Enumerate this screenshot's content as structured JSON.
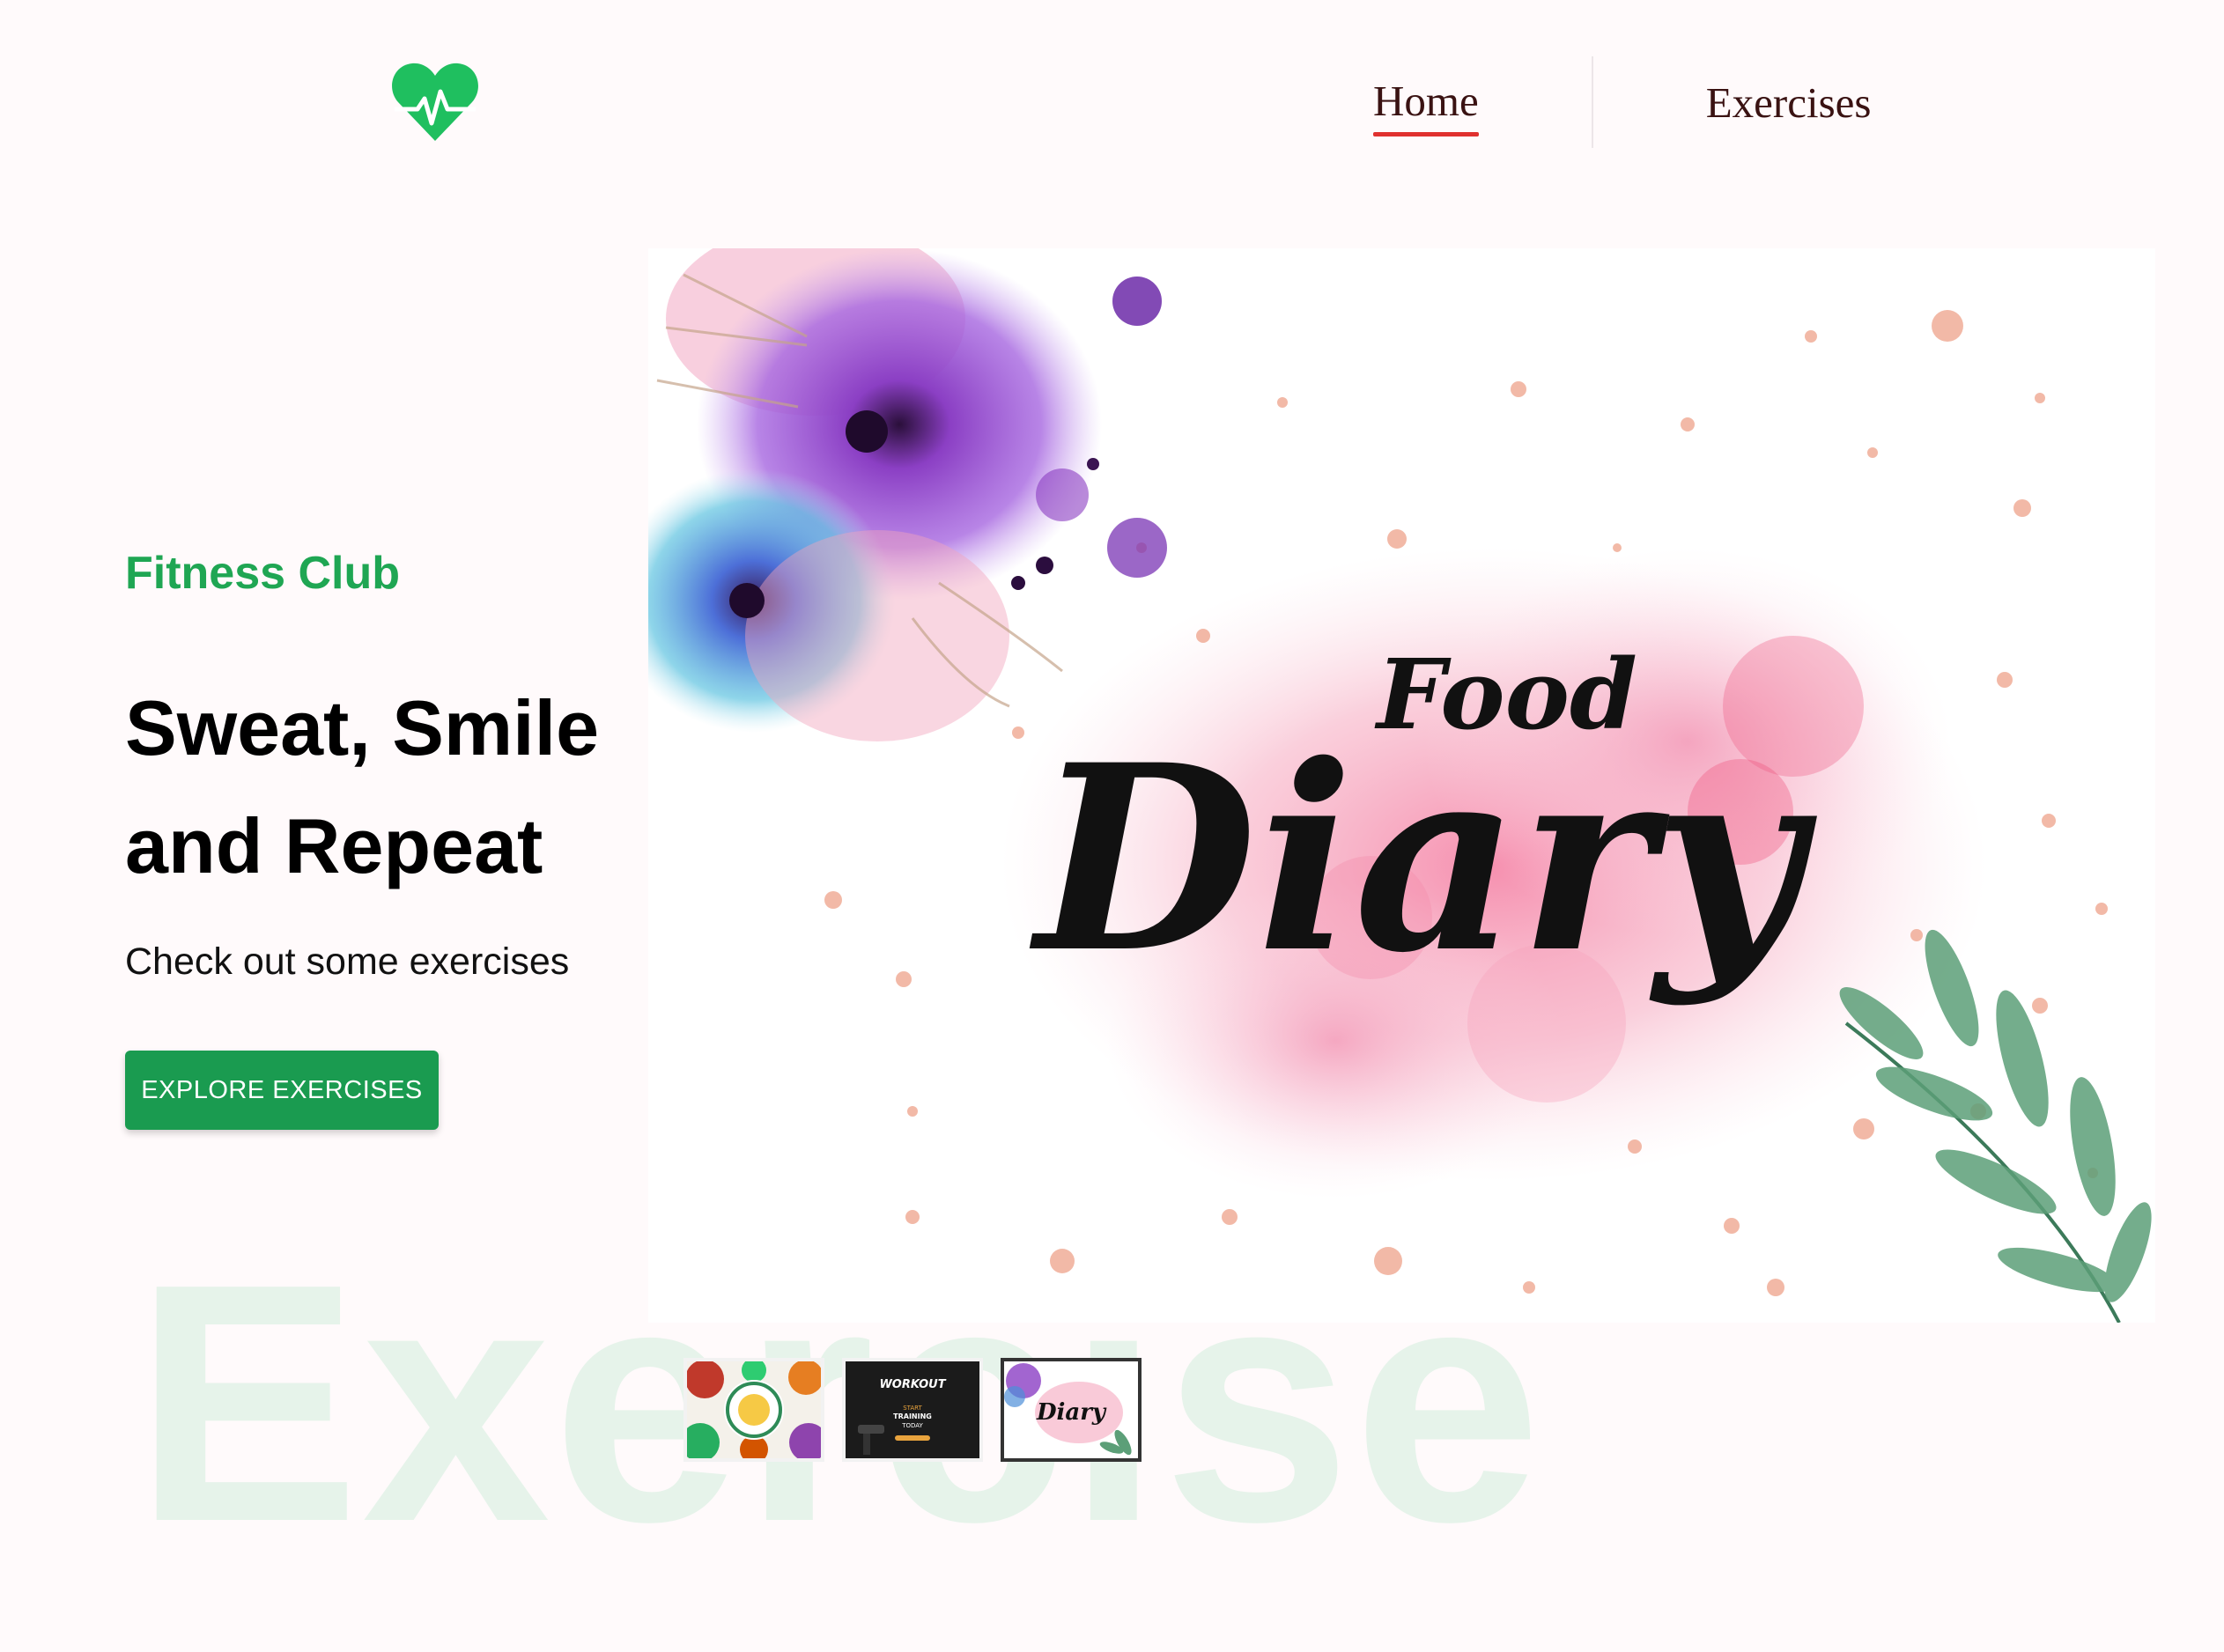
{
  "header": {
    "logo_icon": "heart-pulse-icon",
    "brand_color": "#1fa653",
    "nav": [
      {
        "label": "Home",
        "active": true
      },
      {
        "label": "Exercises",
        "active": false
      }
    ],
    "active_underline_color": "#e0312f"
  },
  "hero": {
    "kicker": "Fitness Club",
    "headline": "Sweat, Smile and Repeat",
    "subtext": "Check out some exercises",
    "cta_label": "EXPLORE EXERCISES",
    "watermark": "Exercise"
  },
  "banner": {
    "title_small": "Food",
    "title_large": "Diary"
  },
  "thumbnails": [
    {
      "name": "healthy-food-thumbnail",
      "active": false
    },
    {
      "name": "workout-thumbnail",
      "text_top": "WORKOUT",
      "text_mid": "START",
      "text_mid2": "TRAINING",
      "text_mid3": "TODAY",
      "active": false
    },
    {
      "name": "food-diary-thumbnail",
      "text": "Diary",
      "active": true
    }
  ],
  "colors": {
    "cta_background": "#1a9b50",
    "watermark": "#e6f3ea",
    "page_background": "#fffafb"
  }
}
